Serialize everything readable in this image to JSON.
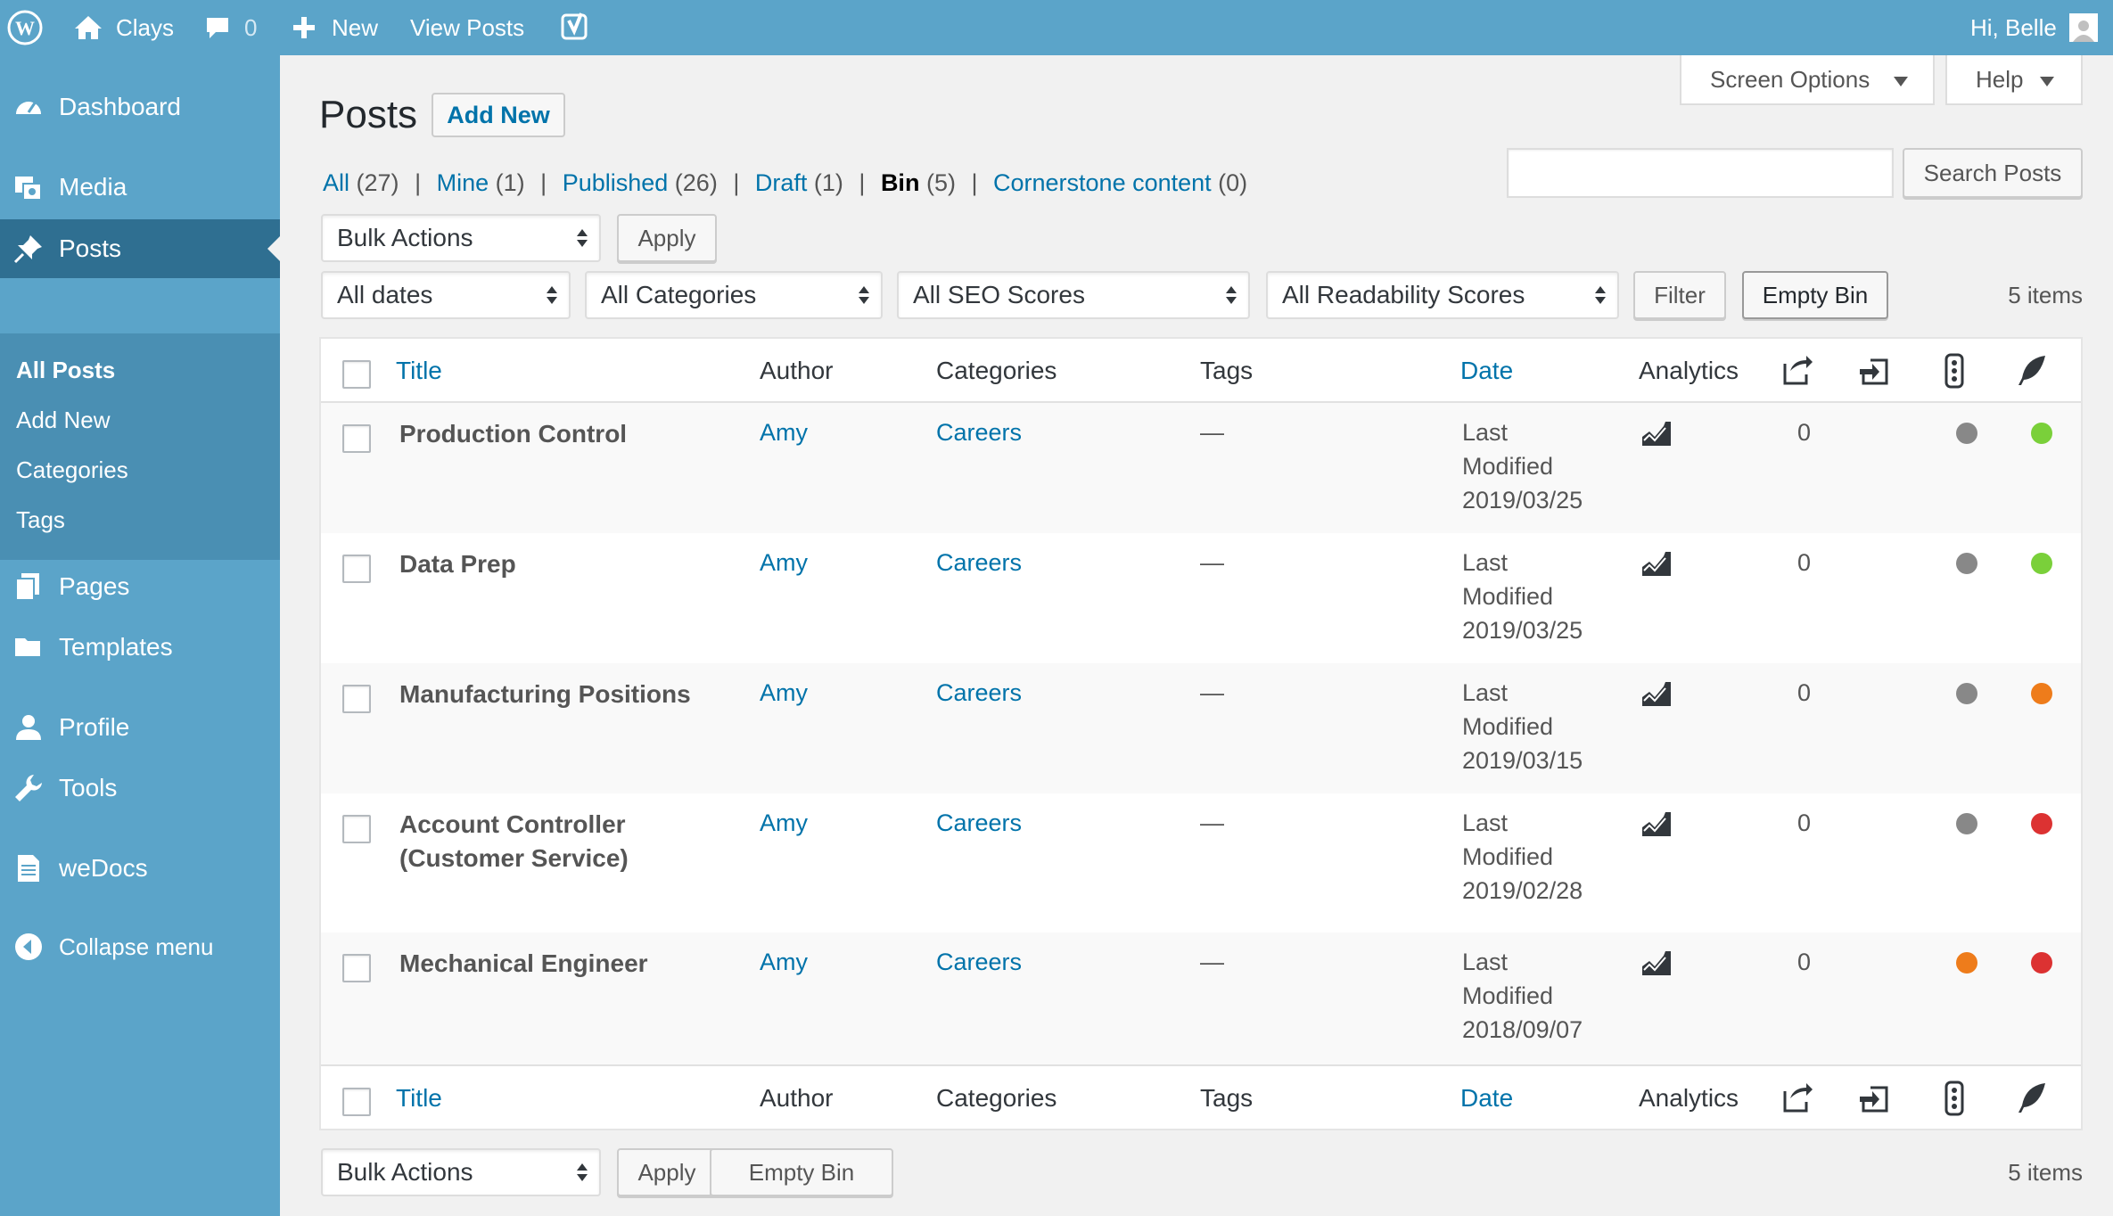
{
  "adminbar": {
    "site_name": "Clays",
    "comments_count": "0",
    "new_label": "New",
    "view_posts": "View Posts",
    "greeting": "Hi, Belle"
  },
  "sidebar": {
    "items": [
      {
        "label": "Dashboard",
        "icon": "dashboard-icon"
      },
      {
        "label": "Media",
        "icon": "media-icon"
      },
      {
        "label": "Posts",
        "icon": "pin-icon"
      },
      {
        "label": "Pages",
        "icon": "pages-icon"
      },
      {
        "label": "Templates",
        "icon": "folder-icon"
      },
      {
        "label": "Profile",
        "icon": "user-icon"
      },
      {
        "label": "Tools",
        "icon": "wrench-icon"
      },
      {
        "label": "weDocs",
        "icon": "document-icon"
      },
      {
        "label": "Collapse menu",
        "icon": "collapse-icon"
      }
    ],
    "submenu": [
      "All Posts",
      "Add New",
      "Categories",
      "Tags"
    ]
  },
  "header": {
    "title": "Posts",
    "add_new": "Add New",
    "screen_options": "Screen Options",
    "help": "Help"
  },
  "search": {
    "placeholder": "",
    "button": "Search Posts"
  },
  "views": [
    {
      "label": "All",
      "count": "(27)"
    },
    {
      "label": "Mine",
      "count": "(1)"
    },
    {
      "label": "Published",
      "count": "(26)"
    },
    {
      "label": "Draft",
      "count": "(1)"
    },
    {
      "label": "Bin",
      "count": "(5)",
      "current": true
    },
    {
      "label": "Cornerstone content",
      "count": "(0)"
    }
  ],
  "separator": "|",
  "toolbar": {
    "bulk_actions": "Bulk Actions",
    "apply": "Apply",
    "dates": "All dates",
    "categories": "All Categories",
    "seo": "All SEO Scores",
    "readability": "All Readability Scores",
    "filter": "Filter",
    "empty_bin": "Empty Bin",
    "items_count": "5 items"
  },
  "table": {
    "columns": [
      "Title",
      "Author",
      "Categories",
      "Tags",
      "Date",
      "Analytics"
    ],
    "column_icons": [
      "outgoing-links-icon",
      "incoming-links-icon",
      "traffic-light-icon",
      "quill-icon"
    ],
    "rows": [
      {
        "title": "Production Control",
        "author": "Amy",
        "category": "Careers",
        "tags": "—",
        "date_label_1": "Last",
        "date_label_2": "Modified",
        "date": "2019/03/25",
        "links": "0",
        "seo": "#888888",
        "readability": "#7ad03a"
      },
      {
        "title": "Data Prep",
        "author": "Amy",
        "category": "Careers",
        "tags": "—",
        "date_label_1": "Last",
        "date_label_2": "Modified",
        "date": "2019/03/25",
        "links": "0",
        "seo": "#888888",
        "readability": "#7ad03a"
      },
      {
        "title": "Manufacturing Positions",
        "author": "Amy",
        "category": "Careers",
        "tags": "—",
        "date_label_1": "Last",
        "date_label_2": "Modified",
        "date": "2019/03/15",
        "links": "0",
        "seo": "#888888",
        "readability": "#ee7c1b"
      },
      {
        "title": "Account Controller (Customer Service)",
        "author": "Amy",
        "category": "Careers",
        "tags": "—",
        "date_label_1": "Last",
        "date_label_2": "Modified",
        "date": "2019/02/28",
        "links": "0",
        "seo": "#888888",
        "readability": "#dc3232"
      },
      {
        "title": "Mechanical Engineer",
        "author": "Amy",
        "category": "Careers",
        "tags": "—",
        "date_label_1": "Last",
        "date_label_2": "Modified",
        "date": "2018/09/07",
        "links": "0",
        "seo": "#ee7c1b",
        "readability": "#dc3232"
      }
    ]
  },
  "colors": {
    "sidebar": "#5ba4c9",
    "sidebar_current": "#2f6f91",
    "link": "#0073aa",
    "good": "#7ad03a",
    "ok": "#ee7c1b",
    "bad": "#dc3232",
    "none": "#888888"
  }
}
